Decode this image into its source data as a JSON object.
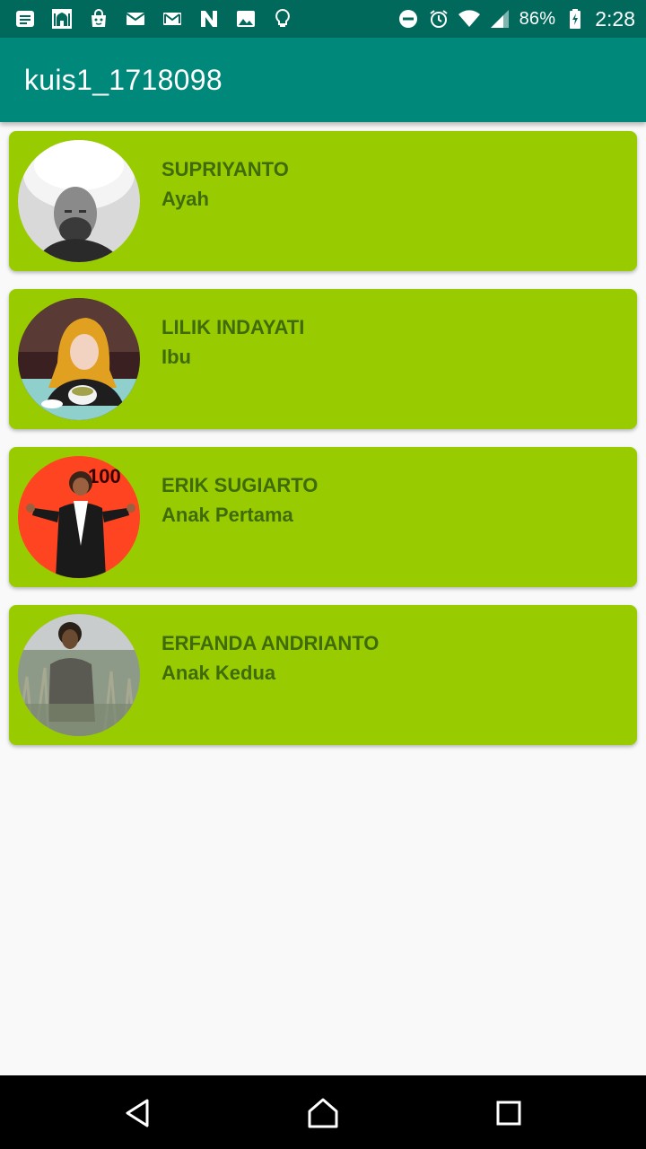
{
  "status_bar": {
    "battery": "86%",
    "time": "2:28",
    "left_icons": [
      "notes-icon",
      "mosque-app-icon",
      "bag-icon",
      "mail-icon",
      "gmail-icon",
      "n-app-icon",
      "image-icon",
      "bulb-icon"
    ],
    "right_icons": [
      "do-not-disturb-icon",
      "alarm-icon",
      "wifi-icon",
      "signal-icon",
      "battery-charging-icon"
    ]
  },
  "app_bar": {
    "title": "kuis1_1718098"
  },
  "family": [
    {
      "name": "SUPRIYANTO",
      "role": "Ayah"
    },
    {
      "name": "LILIK INDAYATI",
      "role": "Ibu"
    },
    {
      "name": "ERIK SUGIARTO",
      "role": "Anak Pertama"
    },
    {
      "name": "ERFANDA ANDRIANTO",
      "role": "Anak Kedua"
    }
  ],
  "nav_bar": {
    "icons": [
      "back-icon",
      "home-icon",
      "recents-icon"
    ]
  },
  "colors": {
    "status_bar": "#00695c",
    "app_bar": "#00897b",
    "card": "#99cc00",
    "card_text": "#3f6b0a",
    "background": "#f9f9f9"
  }
}
